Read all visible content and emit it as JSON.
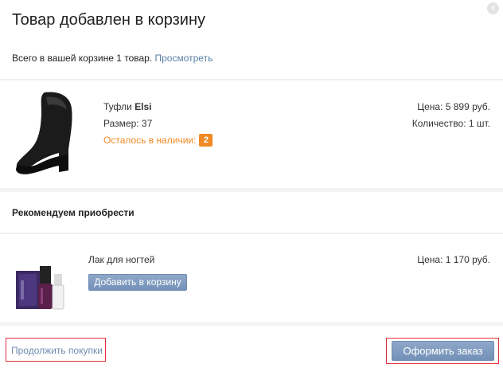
{
  "dialog": {
    "title": "Товар добавлен в корзину",
    "close_glyph": "×"
  },
  "summary": {
    "text": "Всего в вашей корзине 1 товар. ",
    "view_link": "Просмотреть"
  },
  "product": {
    "name_prefix": "Туфли ",
    "brand": "Elsi",
    "size": "Размер: 37",
    "stock_label": "Осталось в наличии:",
    "stock_count": "2",
    "price": "Цена: 5 899 руб.",
    "quantity": "Количество: 1 шт.",
    "image_icon": "shoe-image"
  },
  "recommend": {
    "heading": "Рекомендуем приобрести",
    "items": [
      {
        "name": "Лак для ногтей",
        "price": "Цена: 1 170 руб.",
        "add_button": "Добавить в корзину",
        "image_icon": "nail-polish-image"
      }
    ]
  },
  "footer": {
    "continue_link": "Продолжить покупки",
    "checkout_button": "Оформить заказ"
  },
  "colors": {
    "accent_link": "#5a7fa6",
    "button_blue": "#7f9bc0",
    "stock_orange": "#f08a24",
    "highlight_red": "#e0303a"
  }
}
